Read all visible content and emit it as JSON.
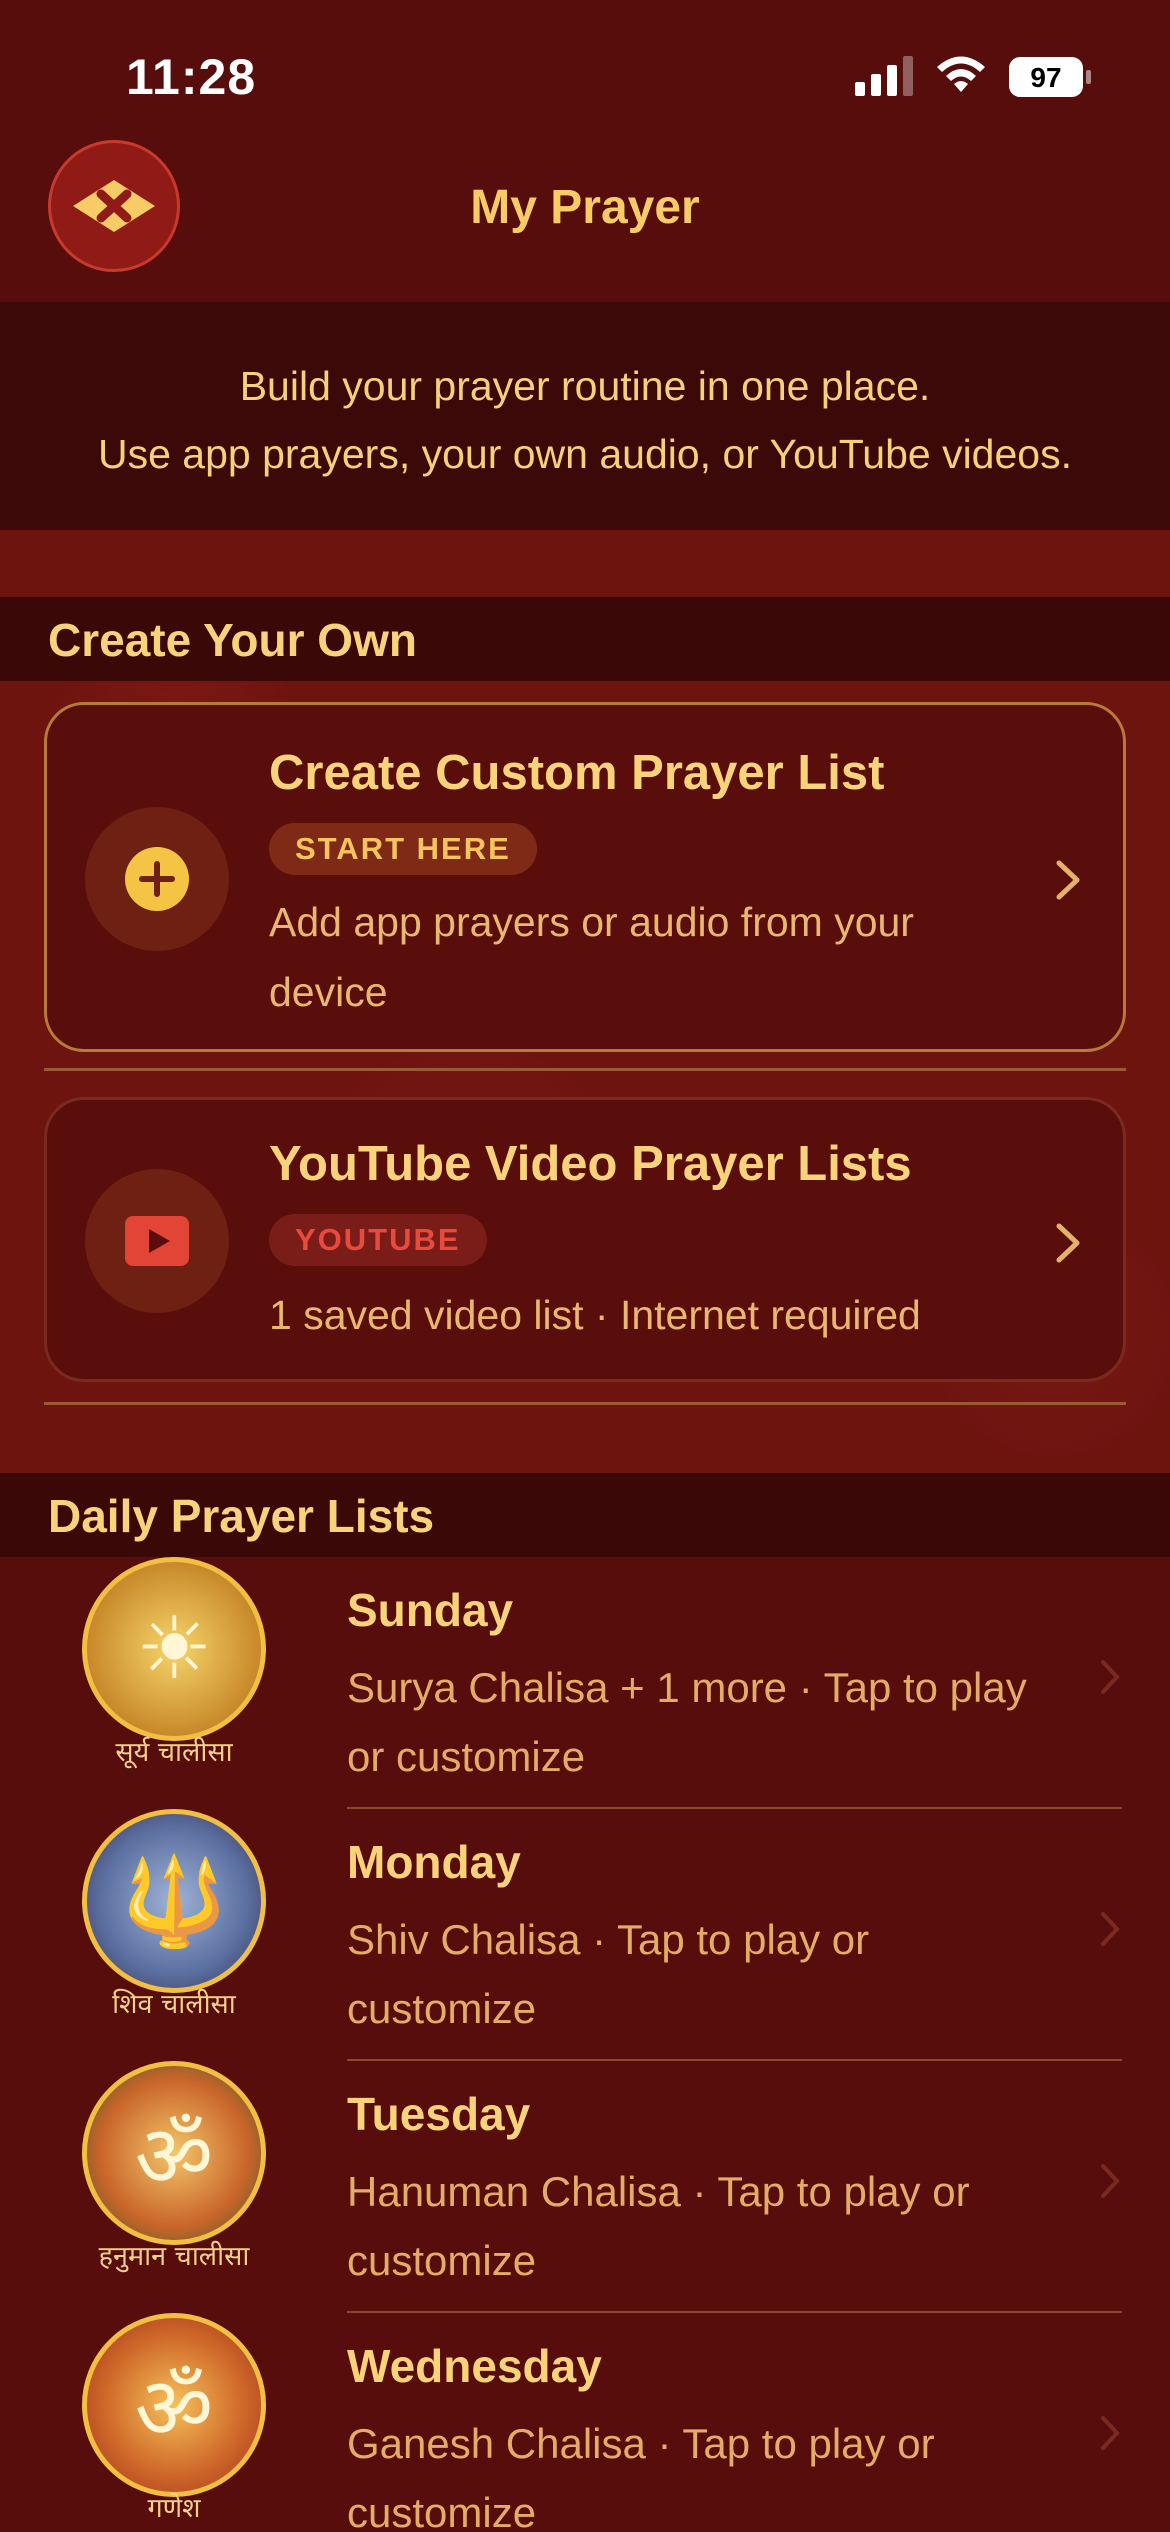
{
  "status_bar": {
    "time": "11:28",
    "battery": "97"
  },
  "nav": {
    "title": "My Prayer",
    "close_icon": "close-icon"
  },
  "intro": {
    "line1": "Build your prayer routine in one place.",
    "line2": "Use app prayers, your own audio, or YouTube videos."
  },
  "sections": {
    "create_own": "Create Your Own",
    "daily": "Daily Prayer Lists"
  },
  "cards": {
    "custom": {
      "title": "Create Custom Prayer List",
      "badge": "START HERE",
      "desc": "Add app prayers or audio from your device",
      "icon": "plus-circle-icon"
    },
    "youtube": {
      "title": "YouTube Video Prayer Lists",
      "badge": "YOUTUBE",
      "desc": "1 saved video list · Internet required",
      "icon": "youtube-play-icon"
    }
  },
  "days": [
    {
      "day": "Sunday",
      "desc": "Surya Chalisa + 1 more · Tap to play or customize",
      "label": "सूर्य चालीसा",
      "bg": "#c89a2a"
    },
    {
      "day": "Monday",
      "desc": "Shiv Chalisa · Tap to play or customize",
      "label": "शिव चालीसा",
      "bg": "#6a7fb0"
    },
    {
      "day": "Tuesday",
      "desc": "Hanuman Chalisa · Tap to play or customize",
      "label": "हनुमान चालीसा",
      "bg": "#b8531e"
    },
    {
      "day": "Wednesday",
      "desc": "Ganesh Chalisa · Tap to play or customize",
      "label": "गणेश",
      "bg": "#c0431f"
    }
  ],
  "colors": {
    "accent": "#f7cc67",
    "background": "#5a0d0b",
    "youtube_red": "#e84a3d"
  }
}
